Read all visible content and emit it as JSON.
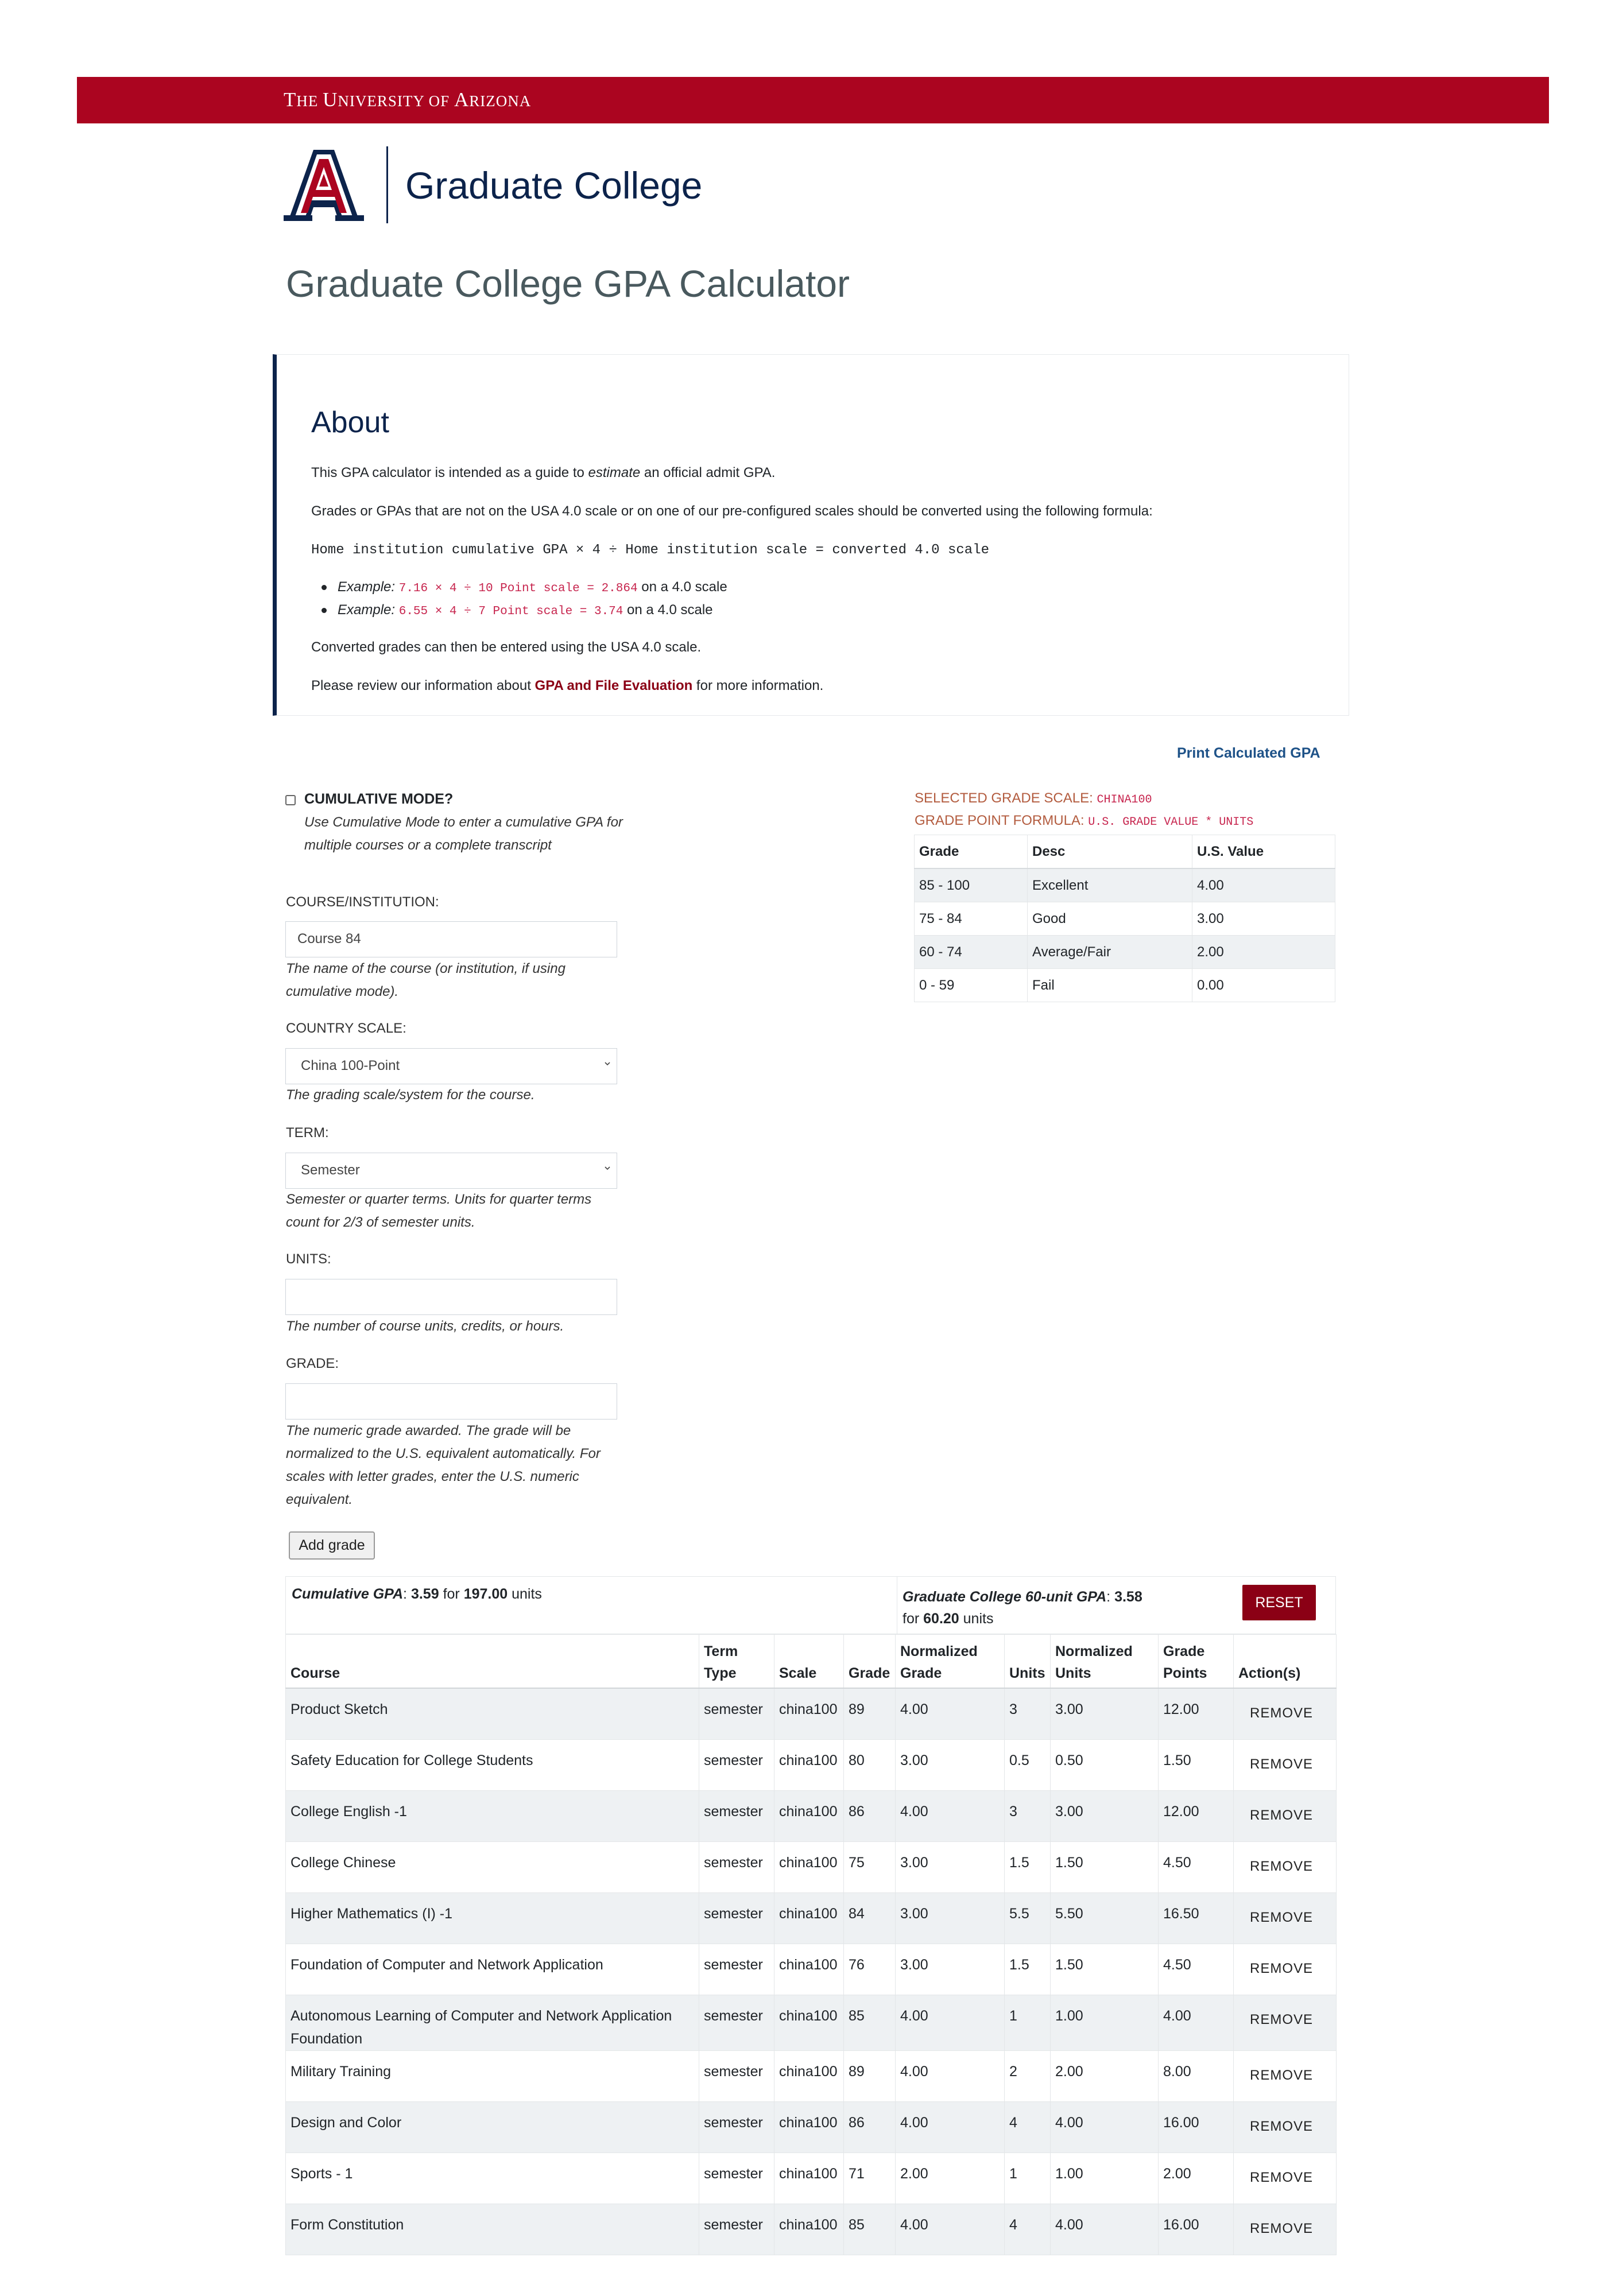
{
  "brand": {
    "university": "THE UNIVERSITY OF ARIZONA",
    "university_parts": [
      "T",
      "HE ",
      "U",
      "NIVERSITY OF ",
      "A",
      "RIZONA"
    ],
    "college": "Graduate College",
    "colors": {
      "red": "#ab0520",
      "navy": "#0c234b",
      "link_red": "#8b0015",
      "link_blue": "#1e5288"
    }
  },
  "page_title": "Graduate College GPA Calculator",
  "about": {
    "heading": "About",
    "p1_before": "This GPA calculator is intended as a guide to ",
    "p1_em": "estimate",
    "p1_after": " an official admit GPA.",
    "p2": "Grades or GPAs that are not on the USA 4.0 scale or on one of our pre-configured scales should be converted using the following formula:",
    "formula": "Home institution cumulative GPA × 4 ÷ Home institution scale = converted 4.0 scale",
    "examples": [
      {
        "label": "Example:",
        "code": "7.16 × 4 ÷ 10 Point scale = 2.864",
        "suffix": " on a 4.0 scale"
      },
      {
        "label": "Example:",
        "code": "6.55 × 4 ÷ 7 Point scale = 3.74",
        "suffix": " on a 4.0 scale"
      }
    ],
    "p3": "Converted grades can then be entered using the USA 4.0 scale.",
    "p4_before": "Please review our information about ",
    "p4_link": "GPA and File Evaluation",
    "p4_after": " for more information."
  },
  "print_link": "Print Calculated GPA",
  "form": {
    "cumulative_label": "CUMULATIVE MODE?",
    "cumulative_checked": false,
    "cumulative_help": "Use Cumulative Mode to enter a cumulative GPA for multiple courses or a complete transcript",
    "course_label": "COURSE/INSTITUTION:",
    "course_value": "Course 84",
    "course_help": "The name of the course (or institution, if using cumulative mode).",
    "country_label": "COUNTRY SCALE:",
    "country_value": "China 100-Point",
    "country_help": "The grading scale/system for the course.",
    "term_label": "TERM:",
    "term_value": "Semester",
    "term_help": "Semester or quarter terms. Units for quarter terms count for 2/3 of semester units.",
    "units_label": "UNITS:",
    "units_value": "",
    "units_help": "The number of course units, credits, or hours.",
    "grade_label": "GRADE:",
    "grade_value": "",
    "grade_help": "The numeric grade awarded. The grade will be normalized to the U.S. equivalent automatically. For scales with letter grades, enter the U.S. numeric equivalent.",
    "add_button": "Add grade"
  },
  "scale_info": {
    "selected_label": "SELECTED GRADE SCALE: ",
    "selected_value": "CHINA100",
    "formula_label": "GRADE POINT FORMULA: ",
    "formula_value": "U.S. GRADE VALUE * UNITS",
    "headers": [
      "Grade",
      "Desc",
      "U.S. Value"
    ],
    "rows": [
      [
        "85 - 100",
        "Excellent",
        "4.00"
      ],
      [
        "75 - 84",
        "Good",
        "3.00"
      ],
      [
        "60 - 74",
        "Average/Fair",
        "2.00"
      ],
      [
        "0 - 59",
        "Fail",
        "0.00"
      ]
    ]
  },
  "summary": {
    "cum_label": "Cumulative GPA",
    "cum_gpa": "3.59",
    "cum_for": "for",
    "cum_units": "197.00",
    "cum_units_word": "units",
    "gc_label": "Graduate College 60-unit GPA",
    "gc_gpa": "3.58",
    "gc_for": "for",
    "gc_units": "60.20",
    "gc_units_word": "units",
    "reset": "RESET"
  },
  "grades_table": {
    "headers": [
      "Course",
      "Term Type",
      "Scale",
      "Grade",
      "Normalized Grade",
      "Units",
      "Normalized Units",
      "Grade Points",
      "Action(s)"
    ],
    "remove_label": "REMOVE",
    "rows": [
      [
        "Product Sketch",
        "semester",
        "china100",
        "89",
        "4.00",
        "3",
        "3.00",
        "12.00"
      ],
      [
        "Safety Education for College Students",
        "semester",
        "china100",
        "80",
        "3.00",
        "0.5",
        "0.50",
        "1.50"
      ],
      [
        "College English -1",
        "semester",
        "china100",
        "86",
        "4.00",
        "3",
        "3.00",
        "12.00"
      ],
      [
        "College Chinese",
        "semester",
        "china100",
        "75",
        "3.00",
        "1.5",
        "1.50",
        "4.50"
      ],
      [
        "Higher Mathematics (I) -1",
        "semester",
        "china100",
        "84",
        "3.00",
        "5.5",
        "5.50",
        "16.50"
      ],
      [
        "Foundation of Computer and Network Application",
        "semester",
        "china100",
        "76",
        "3.00",
        "1.5",
        "1.50",
        "4.50"
      ],
      [
        "Autonomous Learning of Computer and Network Application Foundation",
        "semester",
        "china100",
        "85",
        "4.00",
        "1",
        "1.00",
        "4.00"
      ],
      [
        "Military Training",
        "semester",
        "china100",
        "89",
        "4.00",
        "2",
        "2.00",
        "8.00"
      ],
      [
        "Design and Color",
        "semester",
        "china100",
        "86",
        "4.00",
        "4",
        "4.00",
        "16.00"
      ],
      [
        "Sports - 1",
        "semester",
        "china100",
        "71",
        "2.00",
        "1",
        "1.00",
        "2.00"
      ],
      [
        "Form Constitution",
        "semester",
        "china100",
        "85",
        "4.00",
        "4",
        "4.00",
        "16.00"
      ]
    ]
  }
}
